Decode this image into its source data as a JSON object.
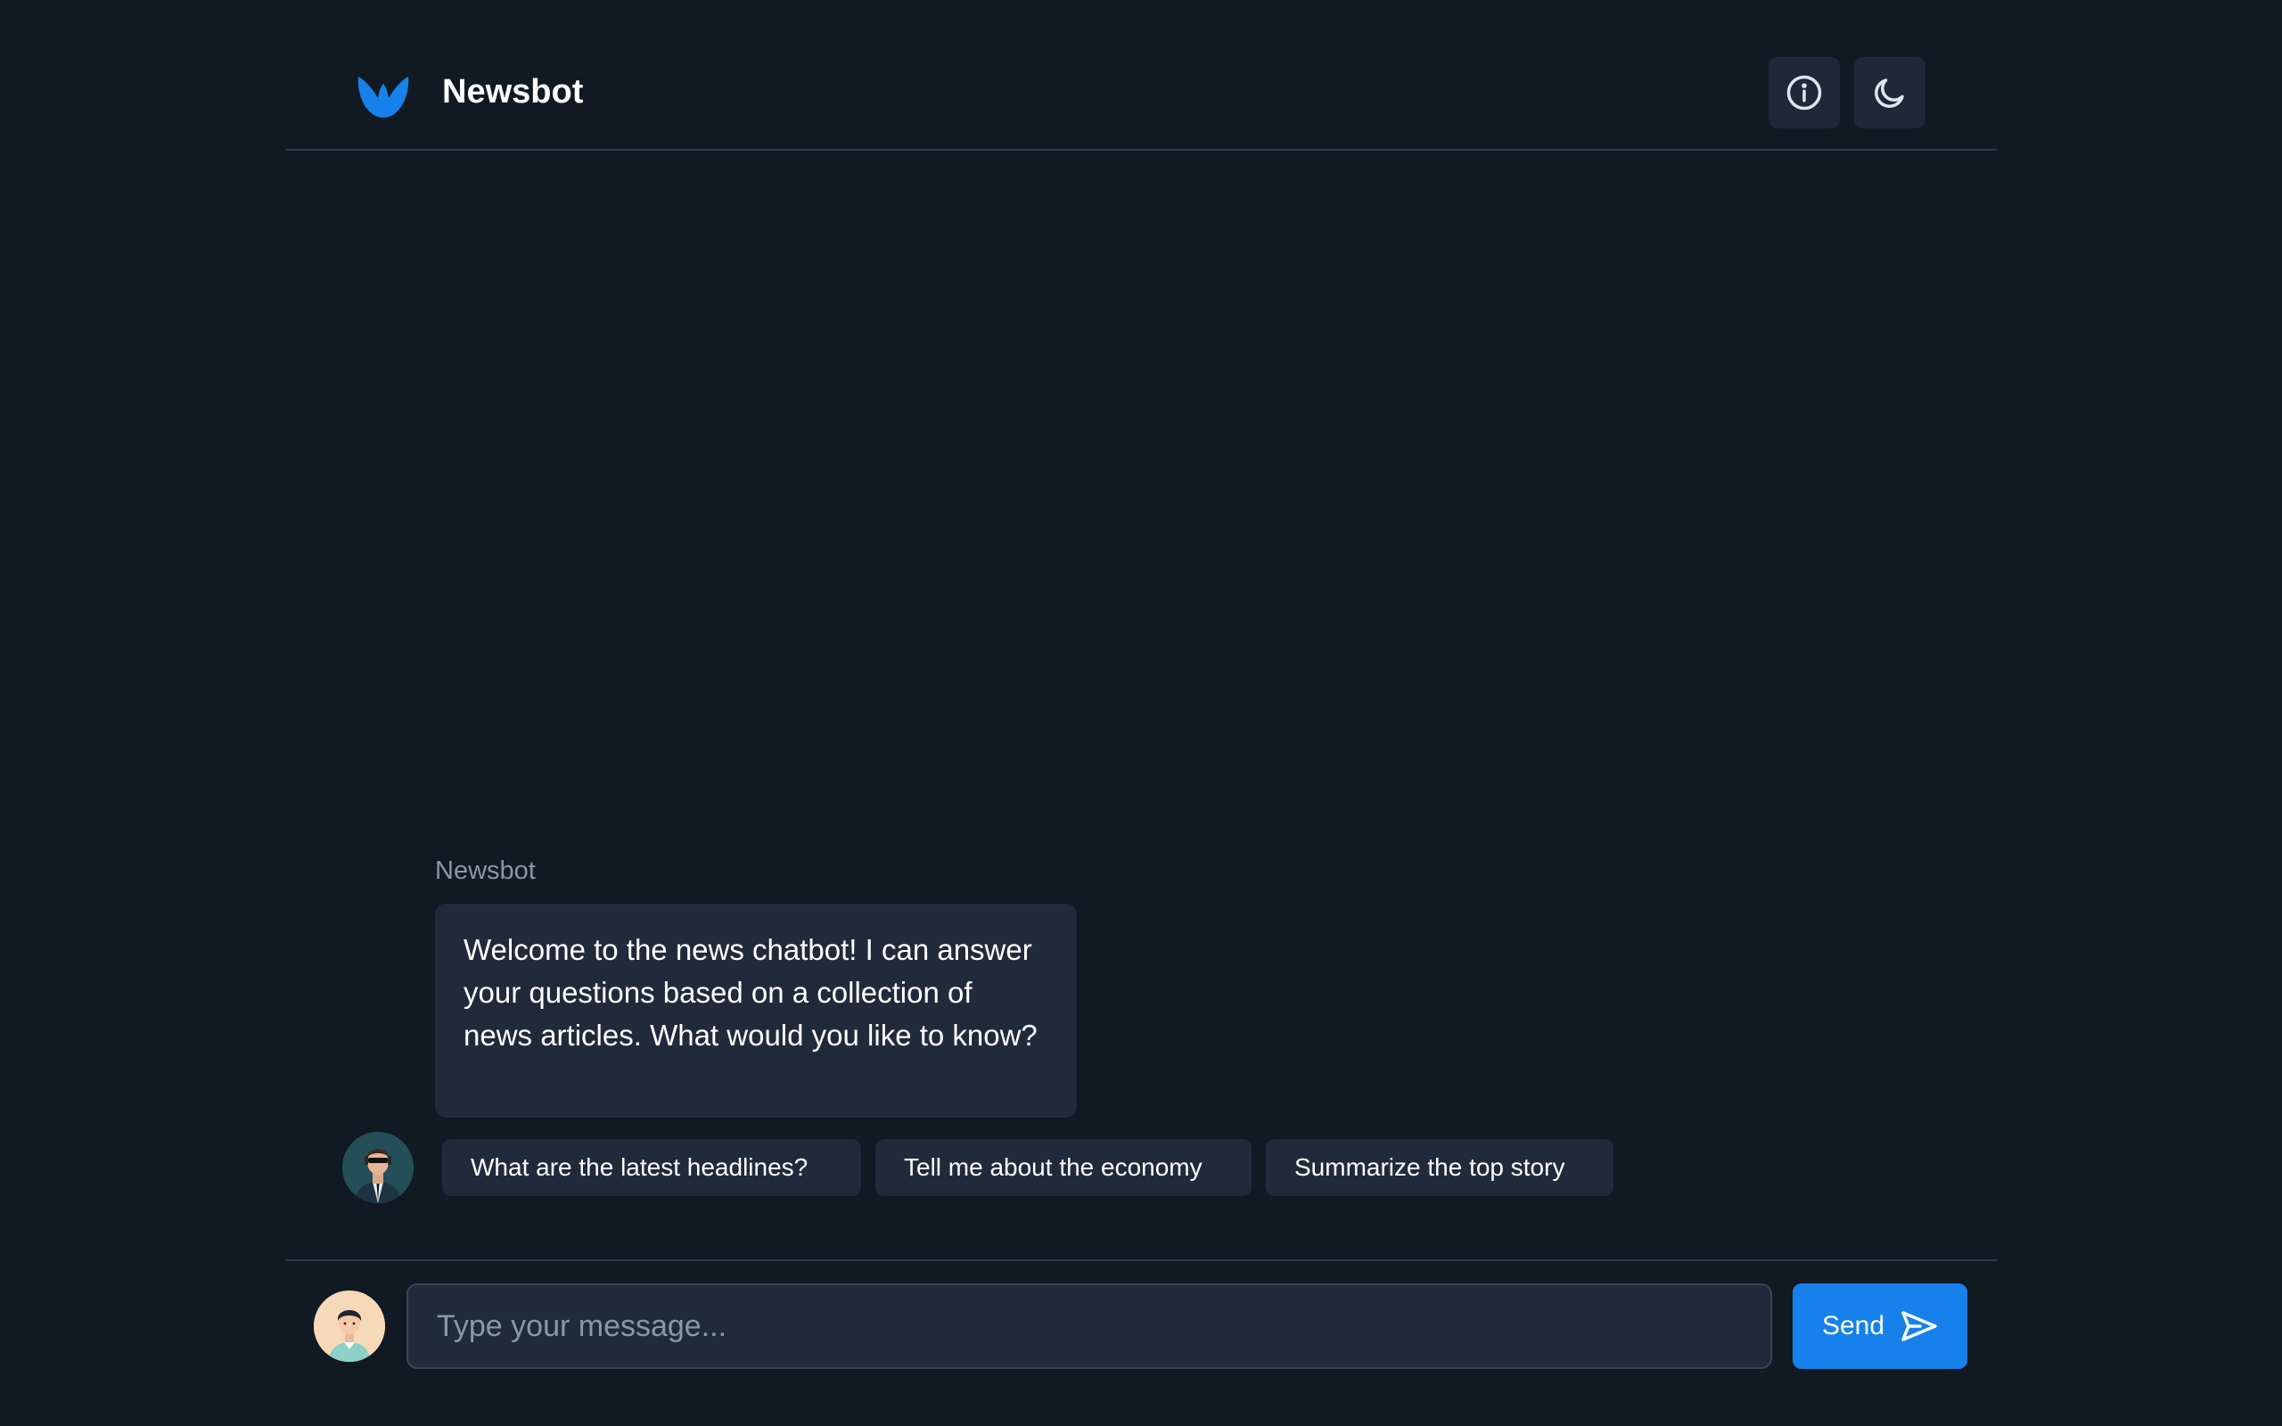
{
  "header": {
    "brand": "Newsbot",
    "logo_icon": "bird-logo-icon",
    "info_icon": "info-icon",
    "theme_icon": "moon-icon"
  },
  "messages": [
    {
      "sender": "Newsbot",
      "text": "Welcome to the news chatbot! I can answer your questions based on a collection of news articles. What would you like to know?"
    }
  ],
  "suggestions": [
    "What are the latest headlines?",
    "Tell me about the economy",
    "Summarize the top story"
  ],
  "composer": {
    "placeholder": "Type your message...",
    "value": "",
    "send_label": "Send",
    "send_icon": "send-icon"
  },
  "colors": {
    "background": "#111923",
    "surface": "#212a3a",
    "accent": "#1681ea",
    "muted_text": "#8a97a6"
  }
}
